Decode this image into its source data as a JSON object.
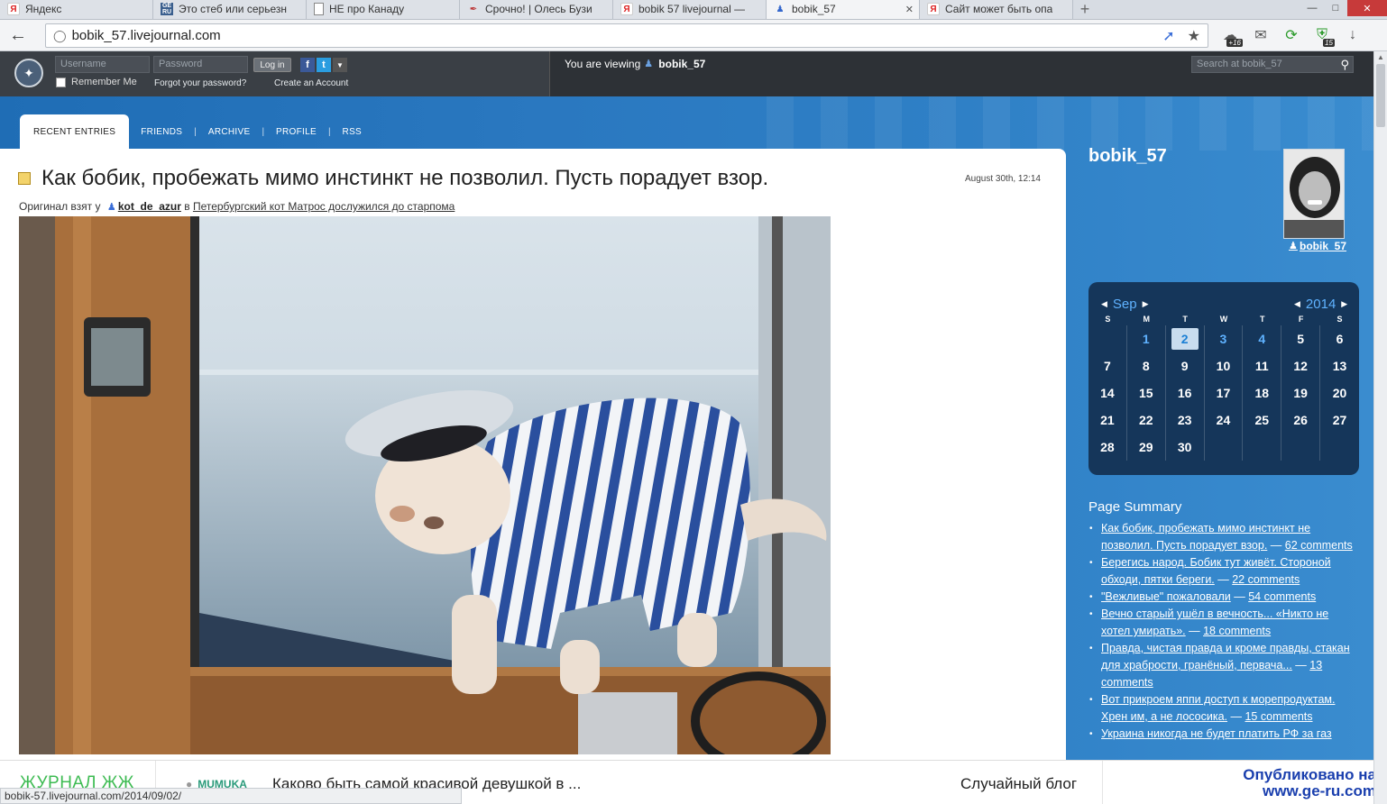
{
  "browser": {
    "tabs": [
      {
        "title": "Яндекс",
        "icon": "yandex-icon",
        "width": 170
      },
      {
        "title": "Это стеб или серьезн",
        "icon": "ge-ru-icon",
        "width": 170
      },
      {
        "title": "НЕ про Канаду",
        "icon": "document-icon",
        "width": 170
      },
      {
        "title": "Срочно! | Олесь Бузи",
        "icon": "feather-icon",
        "width": 170
      },
      {
        "title": "bobik 57 livejournal —",
        "icon": "yandex-icon",
        "width": 170
      },
      {
        "title": "bobik_57",
        "icon": "user-icon",
        "active": true,
        "width": 170
      },
      {
        "title": "Сайт может быть опа",
        "icon": "yandex-icon",
        "width": 170
      }
    ],
    "url": "bobik_57.livejournal.com",
    "toolbar_badges": {
      "sync": "+16",
      "extension": "15"
    },
    "status_url": "bobik-57.livejournal.com/2014/09/02/"
  },
  "lj_header": {
    "username_placeholder": "Username",
    "password_placeholder": "Password",
    "login_label": "Log in",
    "remember_label": "Remember Me",
    "forgot_label": "Forgot your password?",
    "create_label": "Create an Account",
    "viewing_prefix": "You are viewing",
    "viewing_user": "bobik_57",
    "search_placeholder": "Search at bobik_57"
  },
  "nav": {
    "recent": "RECENT ENTRIES",
    "friends": "FRIENDS",
    "archive": "ARCHIVE",
    "profile": "PROFILE",
    "rss": "RSS"
  },
  "entry": {
    "title": "Как бобик, пробежать мимо инстинкт не позволил. Пусть порадует взор.",
    "date": "August 30th, 12:14",
    "orig_prefix": "Оригинал взят у",
    "orig_author": "kot_de_azur",
    "orig_mid": "в",
    "orig_post": "Петербургский кот Матрос дослужился до старпома"
  },
  "sidebar": {
    "username": "bobik_57",
    "avatar_user": "bobik_57",
    "calendar": {
      "month": "Sep",
      "year": "2014",
      "weekdays": [
        "S",
        "M",
        "T",
        "W",
        "T",
        "F",
        "S"
      ],
      "weeks": [
        [
          "",
          "1",
          "2",
          "3",
          "4",
          "5",
          "6"
        ],
        [
          "7",
          "8",
          "9",
          "10",
          "11",
          "12",
          "13"
        ],
        [
          "14",
          "15",
          "16",
          "17",
          "18",
          "19",
          "20"
        ],
        [
          "21",
          "22",
          "23",
          "24",
          "25",
          "26",
          "27"
        ],
        [
          "28",
          "29",
          "30",
          "",
          "",
          "",
          ""
        ]
      ],
      "link_days": [
        "1",
        "3",
        "4"
      ],
      "today": "2"
    },
    "summary_title": "Page Summary",
    "summary": [
      {
        "title": "Как бобик, пробежать мимо инстинкт не позволил. Пусть порадует взор.",
        "comments": "62 comments"
      },
      {
        "title": "Берегись народ. Бобик тут живёт. Стороной обходи, пятки береги.",
        "comments": "22 comments"
      },
      {
        "title": "\"Вежливые\" пожаловали",
        "comments": "54 comments"
      },
      {
        "title": "Вечно старый ушёл в вечность... «Никто не хотел умирать».",
        "comments": "18 comments"
      },
      {
        "title": "Правда, чистая правда и кроме правды, стакан для храбрости, гранёный, первача...",
        "comments": "13 comments"
      },
      {
        "title": "Вот прикроем яппи доступ к морепродуктам. Хрен им, а не лососика.",
        "comments": "15 comments"
      },
      {
        "title": "Украина никогда не будет платить РФ за газ",
        "comments": ""
      }
    ]
  },
  "bottom": {
    "brand": "ЖУРНАЛ ЖЖ",
    "author": "MUMUKA",
    "post": "Каково быть самой красивой девушкой в ...",
    "random": "Случайный блог"
  },
  "watermark": {
    "line1": "Опубликовано на",
    "line2": "www.ge-ru.com"
  }
}
